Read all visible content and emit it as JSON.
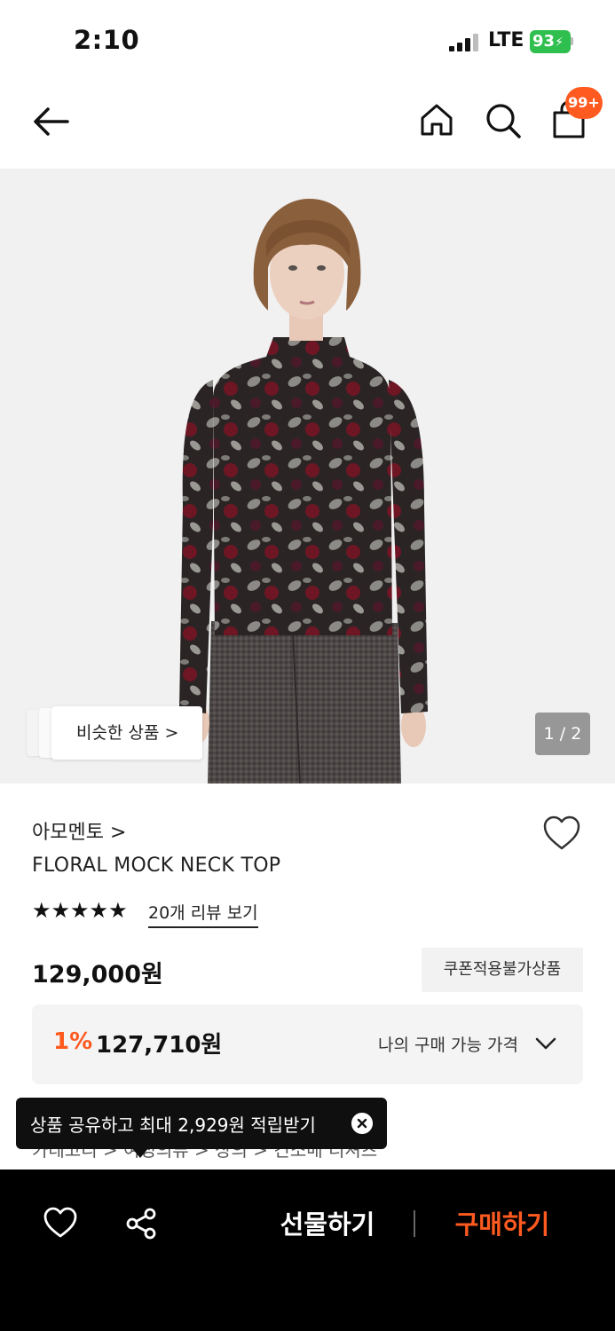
{
  "status_bar": {
    "time": "2:10",
    "network": "LTE",
    "battery": "93"
  },
  "nav": {
    "back_icon": "arrow-left-icon",
    "home_icon": "home-icon",
    "search_icon": "search-icon",
    "bag_icon": "shopping-bag-icon",
    "bag_badge": "99+"
  },
  "product_image": {
    "similar_label": "비슷한 상품 >",
    "page_indicator": "1 / 2"
  },
  "product": {
    "brand": "아모멘토 >",
    "name": "FLORAL MOCK NECK TOP",
    "stars": "★★★★★",
    "rating": 5,
    "review_link": "20개 리뷰 보기",
    "price": "129,000원",
    "coupon_badge": "쿠폰적용불가상품"
  },
  "my_price": {
    "discount": "1%",
    "price": "127,710원",
    "label": "나의 구매 가능 가격"
  },
  "breadcrumb": {
    "text": "카테고리 > 여성의류 > 상의 > 긴소매 티셔츠"
  },
  "toast": {
    "text": "상품 공유하고 최대 2,929원 적립받기"
  },
  "bottom_bar": {
    "gift_label": "선물하기",
    "buy_label": "구매하기"
  },
  "colors": {
    "accent": "#ff5a1f",
    "battery": "#2fbf4f"
  }
}
